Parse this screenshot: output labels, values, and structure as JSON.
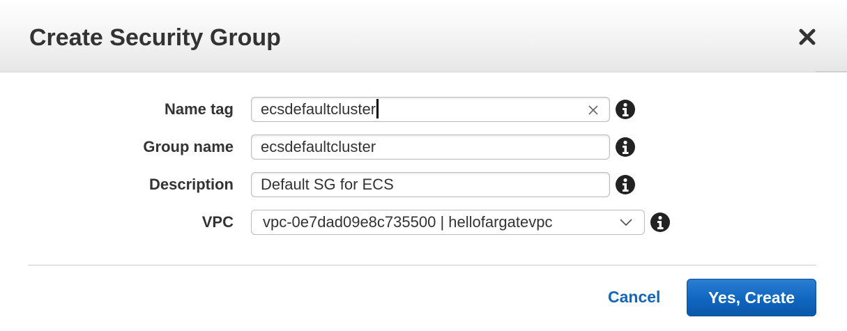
{
  "dialog": {
    "title": "Create Security Group"
  },
  "form": {
    "name_tag": {
      "label": "Name tag",
      "value": "ecsdefaultcluster"
    },
    "group_name": {
      "label": "Group name",
      "value": "ecsdefaultcluster"
    },
    "description": {
      "label": "Description",
      "value": "Default SG for ECS"
    },
    "vpc": {
      "label": "VPC",
      "selected": "vpc-0e7dad09e8c735500 | hellofargatevpc"
    }
  },
  "footer": {
    "cancel_label": "Cancel",
    "create_label": "Yes, Create"
  },
  "icons": {
    "close": "close-icon",
    "clear": "clear-icon",
    "info": "info-icon",
    "dropdown": "chevron-down-icon"
  },
  "colors": {
    "title_text": "#333333",
    "link_blue": "#1166bb",
    "primary_button": "#0f66bf",
    "info_icon": "#222222"
  }
}
